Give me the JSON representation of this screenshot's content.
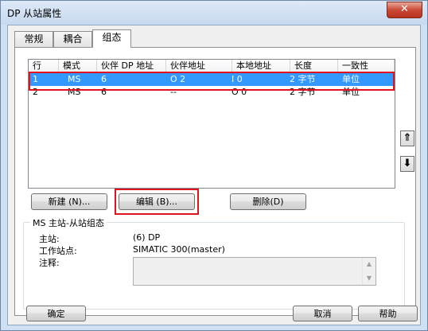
{
  "window": {
    "title": "DP 从站属性",
    "close_glyph": "✕"
  },
  "tabs": [
    {
      "label": "常规"
    },
    {
      "label": "耦合"
    },
    {
      "label": "组态"
    }
  ],
  "list": {
    "columns": [
      "行",
      "模式",
      "伙伴 DP 地址",
      "伙伴地址",
      "本地地址",
      "长度",
      "一致性"
    ],
    "rows": [
      [
        "1",
        "MS",
        "6",
        "",
        "O 2",
        "I 0",
        "2 字节",
        "单位"
      ],
      [
        "2",
        "MS",
        "6",
        "",
        "--",
        "O 0",
        "2 字节",
        "单位"
      ]
    ],
    "selected_row": 1
  },
  "side_buttons": {
    "up_glyph": "⇑",
    "down_glyph": "⬇"
  },
  "actions": {
    "new_label": "新建 (N)...",
    "edit_label": "编辑 (B)...",
    "delete_label": "删除(D)"
  },
  "master_group": {
    "legend": "MS 主站-从站组态",
    "master_label": "主站:",
    "master_value": "(6) DP",
    "station_label": "工作站点:",
    "station_value": "SIMATIC 300(master)",
    "comment_label": "注释:",
    "comment_value": ""
  },
  "footer": {
    "ok_label": "确定",
    "cancel_label": "取消",
    "help_label": "帮助"
  }
}
